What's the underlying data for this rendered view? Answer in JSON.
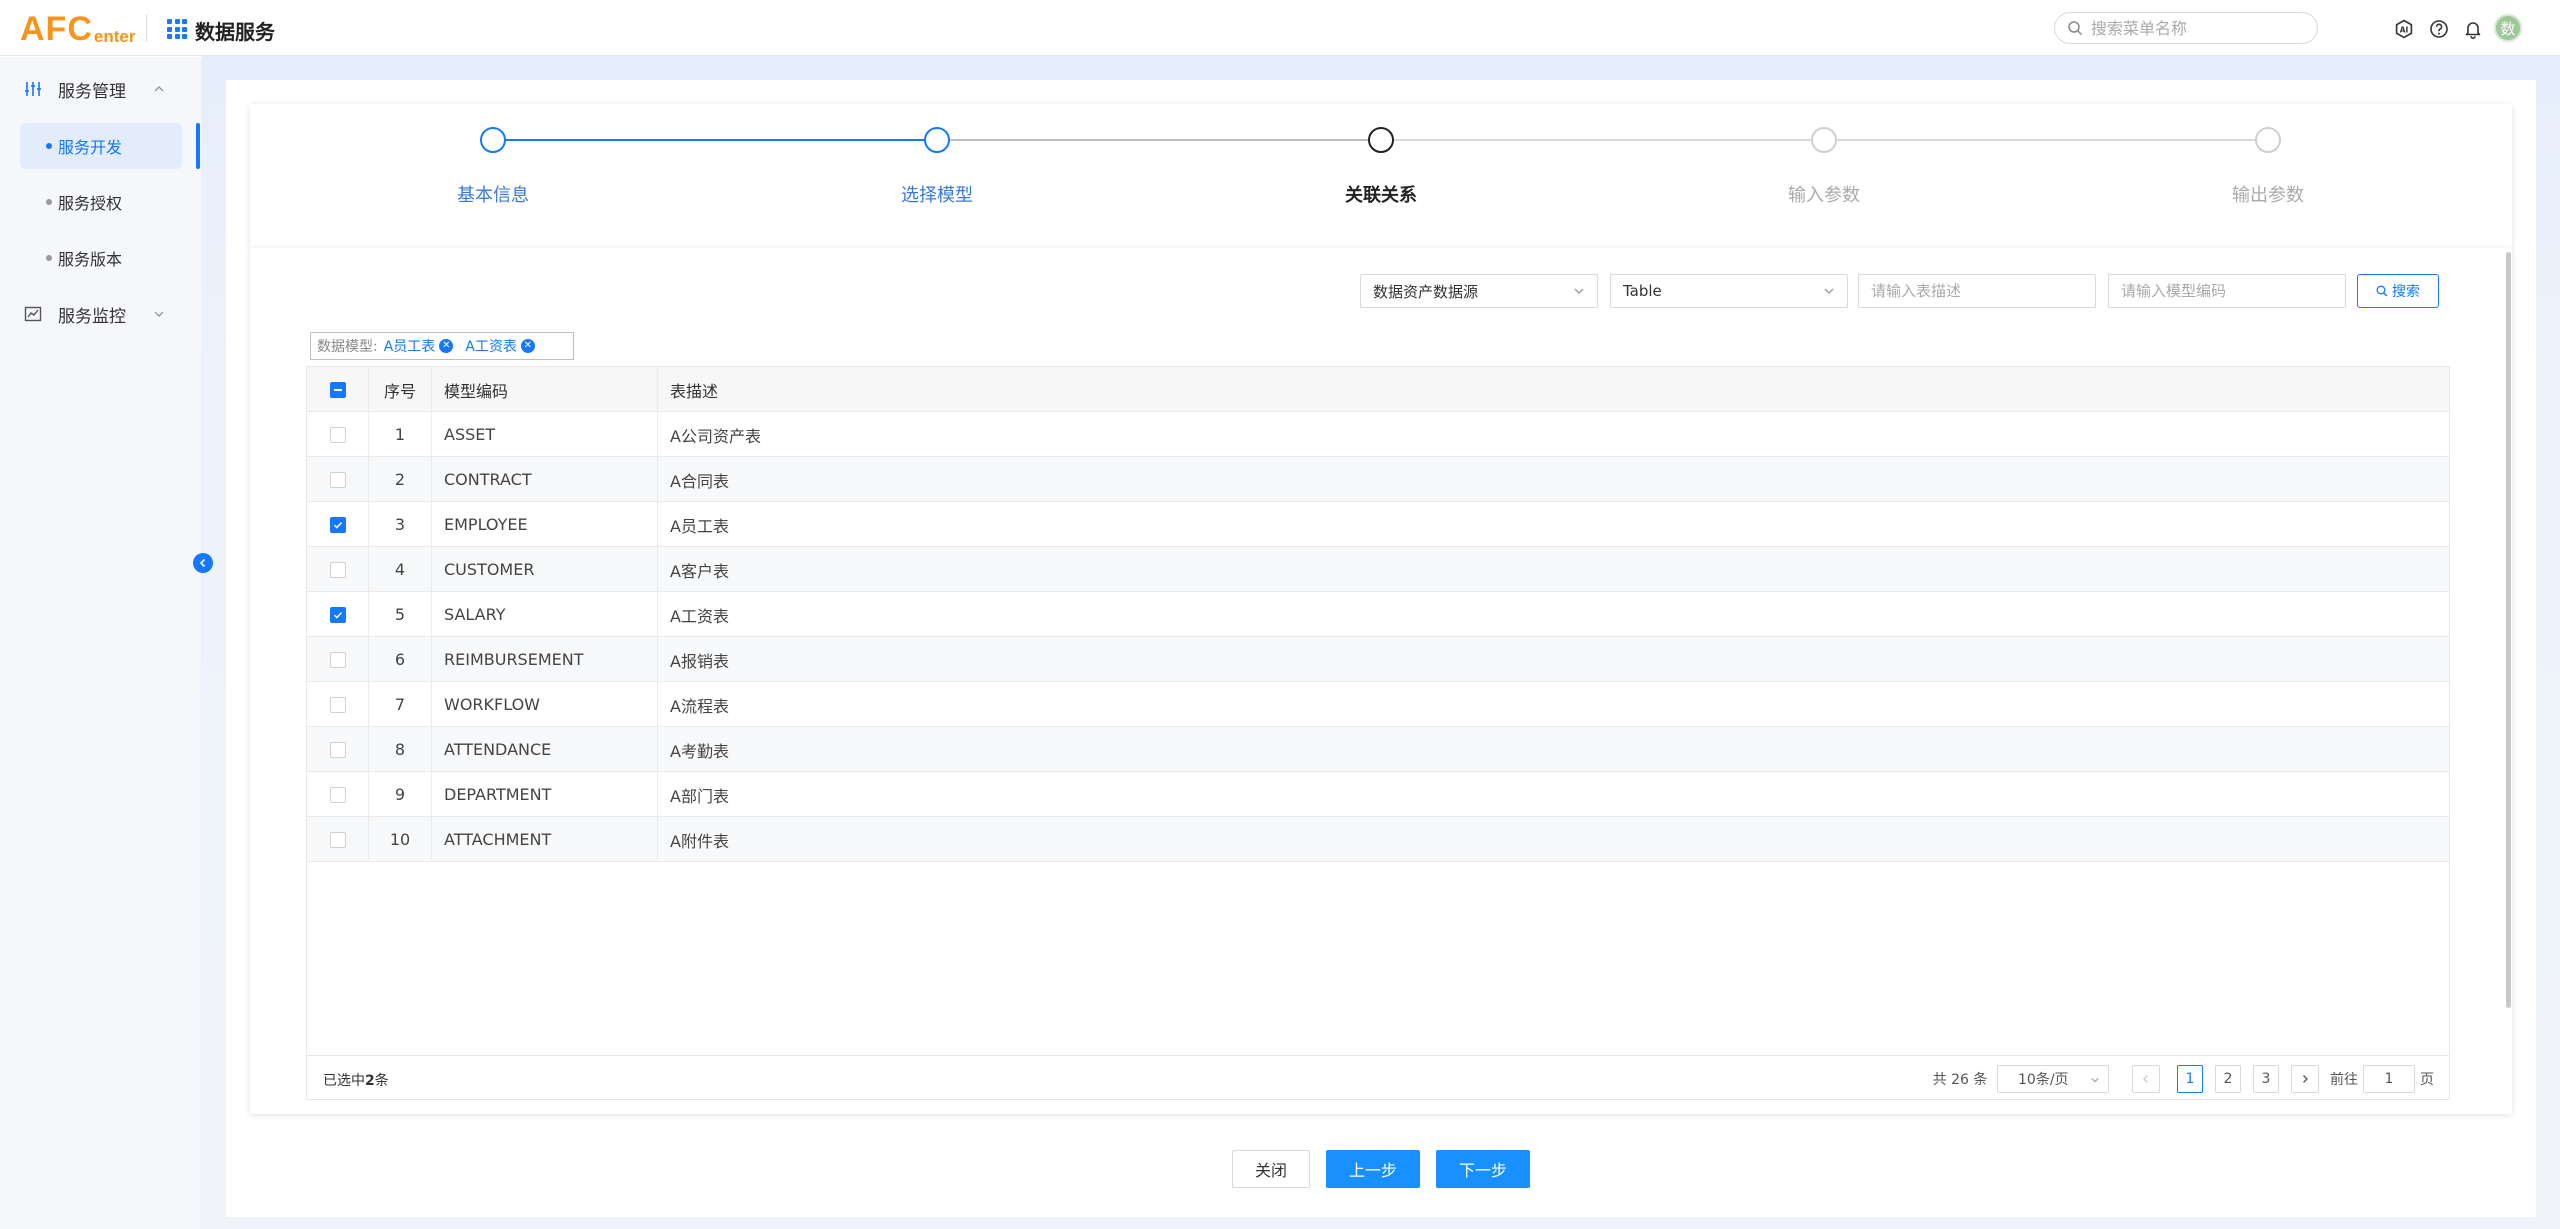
{
  "header": {
    "logo_main": "AFC",
    "logo_sub": "enter",
    "app_title": "数据服务",
    "search_placeholder": "搜索菜单名称",
    "avatar_text": "数"
  },
  "sidebar": {
    "groups": [
      {
        "label": "服务管理",
        "icon": "sliders-icon",
        "expanded": true
      },
      {
        "label": "服务监控",
        "icon": "chart-icon",
        "expanded": false
      }
    ],
    "items": [
      {
        "label": "服务开发",
        "active": true
      },
      {
        "label": "服务授权",
        "active": false
      },
      {
        "label": "服务版本",
        "active": false
      }
    ]
  },
  "steps": [
    {
      "label": "基本信息",
      "state": "done"
    },
    {
      "label": "选择模型",
      "state": "done"
    },
    {
      "label": "关联关系",
      "state": "current"
    },
    {
      "label": "输入参数",
      "state": "pending"
    },
    {
      "label": "输出参数",
      "state": "pending"
    }
  ],
  "filters": {
    "datasource_value": "数据资产数据源",
    "type_value": "Table",
    "desc_placeholder": "请输入表描述",
    "code_placeholder": "请输入模型编码",
    "search_label": "搜索"
  },
  "selected_models": {
    "label": "数据模型:",
    "tags": [
      "A员工表",
      "A工资表"
    ]
  },
  "table": {
    "headers": [
      "序号",
      "模型编码",
      "表描述"
    ],
    "rows": [
      {
        "no": "1",
        "code": "ASSET",
        "desc": "A公司资产表",
        "checked": false
      },
      {
        "no": "2",
        "code": "CONTRACT",
        "desc": "A合同表",
        "checked": false
      },
      {
        "no": "3",
        "code": "EMPLOYEE",
        "desc": "A员工表",
        "checked": true
      },
      {
        "no": "4",
        "code": "CUSTOMER",
        "desc": "A客户表",
        "checked": false
      },
      {
        "no": "5",
        "code": "SALARY",
        "desc": "A工资表",
        "checked": true
      },
      {
        "no": "6",
        "code": "REIMBURSEMENT",
        "desc": "A报销表",
        "checked": false
      },
      {
        "no": "7",
        "code": "WORKFLOW",
        "desc": "A流程表",
        "checked": false
      },
      {
        "no": "8",
        "code": "ATTENDANCE",
        "desc": "A考勤表",
        "checked": false
      },
      {
        "no": "9",
        "code": "DEPARTMENT",
        "desc": "A部门表",
        "checked": false
      },
      {
        "no": "10",
        "code": "ATTACHMENT",
        "desc": "A附件表",
        "checked": false
      }
    ]
  },
  "footer": {
    "selected_prefix": "已选中",
    "selected_count": "2",
    "selected_suffix": "条",
    "total_text": "共 26 条",
    "page_size": "10条/页",
    "pages": [
      "1",
      "2",
      "3"
    ],
    "current_page": "1",
    "goto_prefix": "前往",
    "goto_value": "1",
    "goto_suffix": "页"
  },
  "actions": {
    "close": "关闭",
    "prev": "上一步",
    "next": "下一步"
  },
  "colors": {
    "primary": "#1677ff",
    "logo": "#f7941d"
  }
}
